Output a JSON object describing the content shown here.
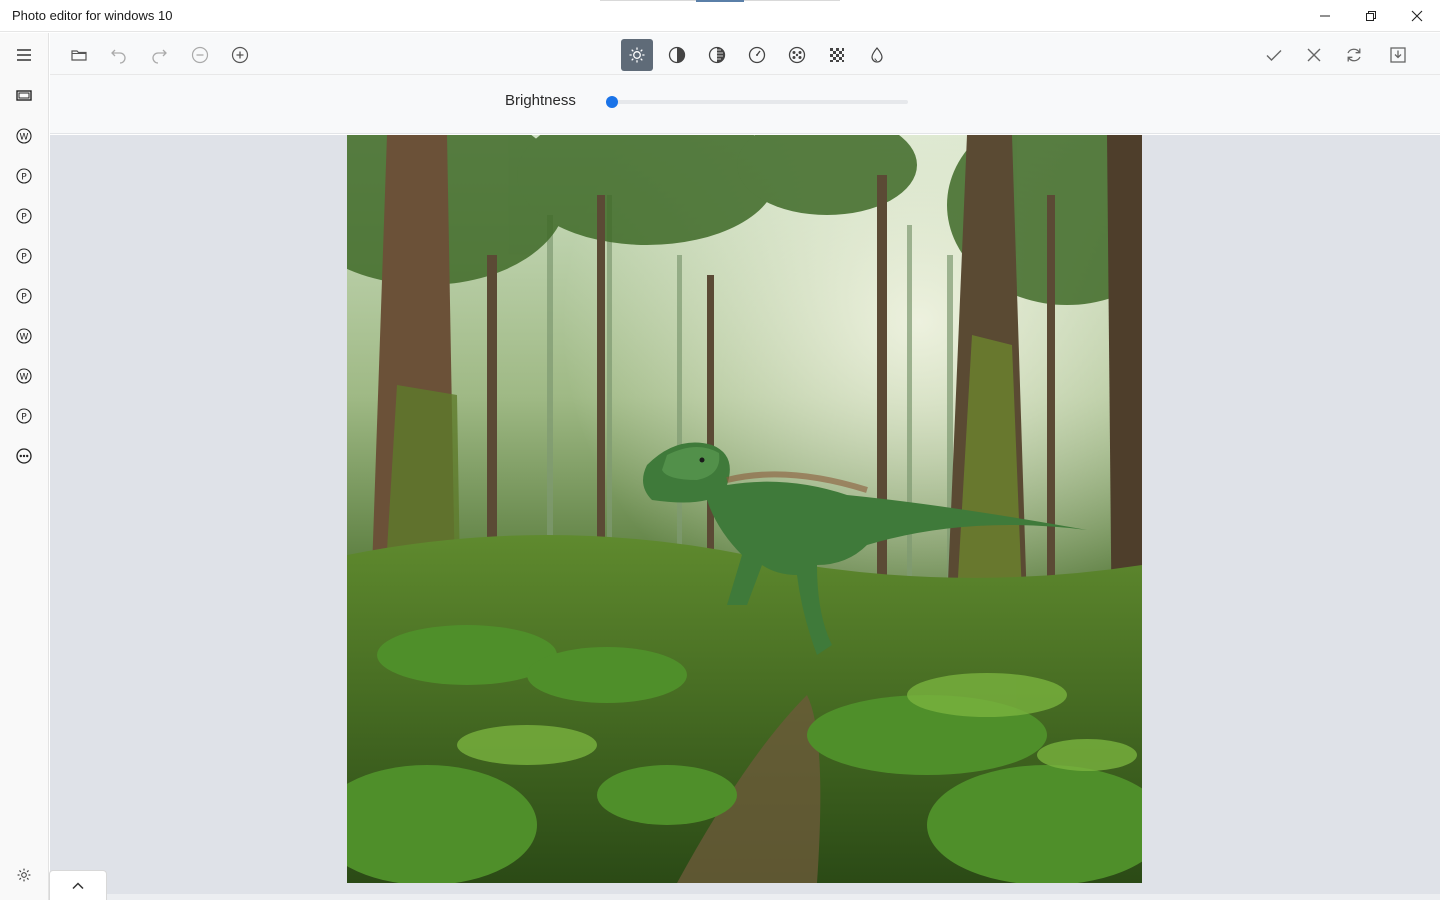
{
  "window": {
    "title": "Photo editor for windows 10",
    "controls": [
      "minimize",
      "restore",
      "close"
    ]
  },
  "sidebar": {
    "items": [
      {
        "icon": "menu-icon"
      },
      {
        "icon": "filmstrip-icon"
      },
      {
        "icon": "w-circle-icon",
        "glyph": "W"
      },
      {
        "icon": "p-circle-icon",
        "glyph": "P"
      },
      {
        "icon": "p-circle-icon",
        "glyph": "P"
      },
      {
        "icon": "p-circle-icon",
        "glyph": "P"
      },
      {
        "icon": "p-circle-icon",
        "glyph": "P"
      },
      {
        "icon": "w-circle-icon",
        "glyph": "W"
      },
      {
        "icon": "w-circle-icon",
        "glyph": "W"
      },
      {
        "icon": "p-circle-icon",
        "glyph": "P"
      },
      {
        "icon": "more-circle-icon"
      }
    ],
    "settings_icon": "gear-icon"
  },
  "toolbar": {
    "left": [
      "open-folder-icon",
      "undo-icon",
      "redo-icon",
      "zoom-out-icon",
      "zoom-in-icon"
    ],
    "center": [
      "brightness-icon",
      "contrast-icon",
      "saturation-icon",
      "exposure-icon",
      "vignette-icon",
      "pixelate-icon",
      "hue-icon"
    ],
    "active": "brightness-icon",
    "right": [
      "apply-check-icon",
      "cancel-x-icon",
      "reset-icon",
      "save-icon"
    ]
  },
  "adjust": {
    "label": "Brightness",
    "value_fraction": 0.0,
    "accent_color": "#1a73e8"
  },
  "canvas": {
    "image_subject": "dinosaur in forest",
    "background_color": "#dfe2e8"
  }
}
